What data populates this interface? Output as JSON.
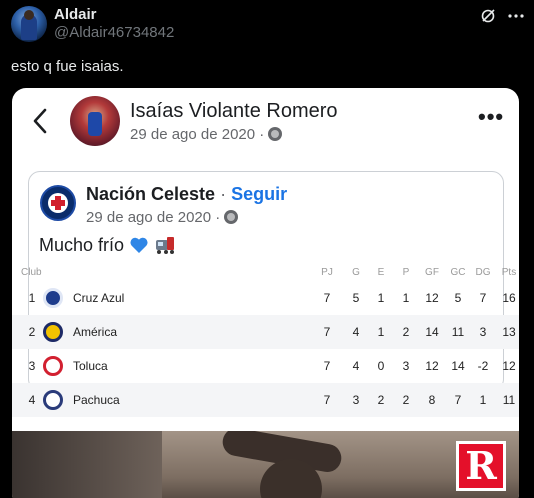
{
  "tweet": {
    "display_name": "Aldair",
    "handle": "@Aldair46734842",
    "text": "esto q fue isaias."
  },
  "post": {
    "author": "Isaías Violante Romero",
    "date": "29 de ago de 2020 · ",
    "more": "•••"
  },
  "shared": {
    "page_name": "Nación Celeste",
    "separator": " · ",
    "follow": "Seguir",
    "date": "29 de ago de 2020 · ",
    "text": "Mucho frío "
  },
  "standings": {
    "headers": {
      "club": "Club",
      "pj": "PJ",
      "g": "G",
      "e": "E",
      "p": "P",
      "gf": "GF",
      "gc": "GC",
      "dg": "DG",
      "pts": "Pts"
    },
    "rows": [
      {
        "pos": "1",
        "name": "Cruz Azul",
        "pj": "7",
        "g": "5",
        "e": "1",
        "p": "1",
        "gf": "12",
        "gc": "5",
        "dg": "7",
        "pts": "16",
        "color": "#1e3c8c"
      },
      {
        "pos": "2",
        "name": "América",
        "pj": "7",
        "g": "4",
        "e": "1",
        "p": "2",
        "gf": "14",
        "gc": "11",
        "dg": "3",
        "pts": "13",
        "color": "#f2c200"
      },
      {
        "pos": "3",
        "name": "Toluca",
        "pj": "7",
        "g": "4",
        "e": "0",
        "p": "3",
        "gf": "12",
        "gc": "14",
        "dg": "-2",
        "pts": "12",
        "color": "#d22030"
      },
      {
        "pos": "4",
        "name": "Pachuca",
        "pj": "7",
        "g": "3",
        "e": "2",
        "p": "2",
        "gf": "8",
        "gc": "7",
        "dg": "1",
        "pts": "11",
        "color": "#2a3b7a"
      }
    ]
  },
  "watermark": {
    "letter": "R",
    "color": "#e4102a"
  },
  "icons": {
    "grok": "grok-icon",
    "more": "more-icon",
    "back": "back-icon",
    "globe": "globe-icon",
    "heart": "blue-heart-icon",
    "train": "train-icon"
  }
}
